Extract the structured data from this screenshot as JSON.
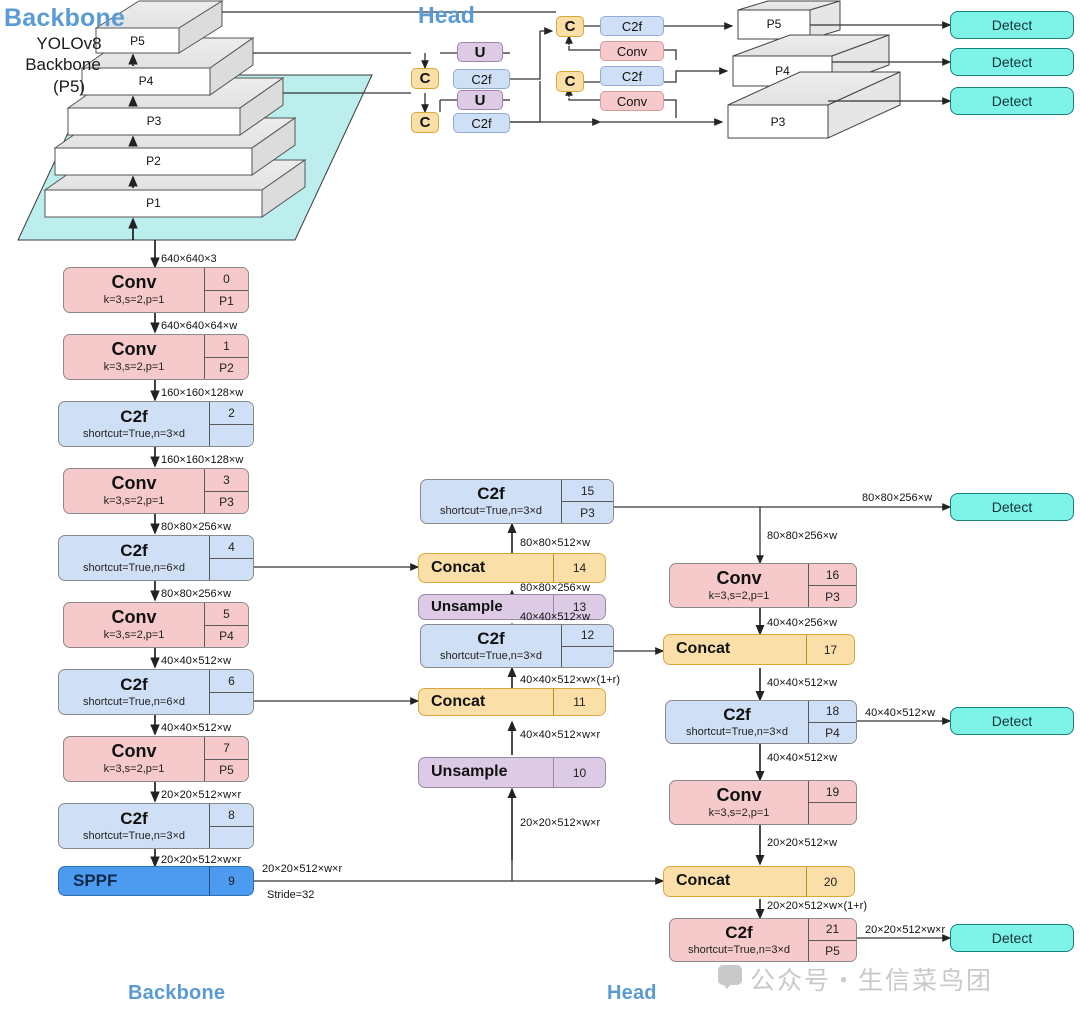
{
  "titles": {
    "backbone_top": "Backbone",
    "head_top": "Head",
    "backbone_bottom": "Backbone",
    "head_bottom": "Head"
  },
  "pyramid": {
    "caption_line1": "YOLOv8",
    "caption_line2": "Backbone",
    "caption_line3": "(P5)",
    "levels": [
      "P5",
      "P4",
      "P3",
      "P2",
      "P1"
    ],
    "input_label": "640×640×3"
  },
  "head_mini": {
    "concat_top": "C",
    "concat_mid": "C",
    "concat_bot": "C",
    "upsample_top": "U",
    "upsample_bot": "U",
    "c2f_top": "C2f",
    "c2f_mid": "C2f",
    "c2f_bot": "C2f",
    "right_c_top": "C",
    "right_c_bot": "C",
    "right_c2f_top": "C2f",
    "right_c2f_bot": "C2f",
    "right_conv_top": "Conv",
    "right_conv_bot": "Conv"
  },
  "head_out_levels": [
    "P5",
    "P4",
    "P3"
  ],
  "detect_label": "Detect",
  "detect_boxes": [
    {
      "label": "Detect"
    },
    {
      "label": "Detect"
    },
    {
      "label": "Detect"
    }
  ],
  "backbone_nodes": [
    {
      "title": "Conv",
      "sub": "k=3,s=2,p=1",
      "idx": "0",
      "tag": "P1",
      "color": "conv"
    },
    {
      "title": "Conv",
      "sub": "k=3,s=2,p=1",
      "idx": "1",
      "tag": "P2",
      "color": "conv"
    },
    {
      "title": "C2f",
      "sub": "shortcut=True,n=3×d",
      "idx": "2",
      "tag": "",
      "color": "c2f"
    },
    {
      "title": "Conv",
      "sub": "k=3,s=2,p=1",
      "idx": "3",
      "tag": "P3",
      "color": "conv"
    },
    {
      "title": "C2f",
      "sub": "shortcut=True,n=6×d",
      "idx": "4",
      "tag": "",
      "color": "c2f"
    },
    {
      "title": "Conv",
      "sub": "k=3,s=2,p=1",
      "idx": "5",
      "tag": "P4",
      "color": "conv"
    },
    {
      "title": "C2f",
      "sub": "shortcut=True,n=6×d",
      "idx": "6",
      "tag": "",
      "color": "c2f"
    },
    {
      "title": "Conv",
      "sub": "k=3,s=2,p=1",
      "idx": "7",
      "tag": "P5",
      "color": "conv"
    },
    {
      "title": "C2f",
      "sub": "shortcut=True,n=3×d",
      "idx": "8",
      "tag": "",
      "color": "c2f"
    },
    {
      "title": "SPPF",
      "sub": "",
      "idx": "9",
      "tag": "",
      "color": "sppf"
    }
  ],
  "backbone_edges": [
    "640×640×3",
    "640×640×64×w",
    "160×160×128×w",
    "160×160×128×w",
    "80×80×256×w",
    "80×80×256×w",
    "40×40×512×w",
    "40×40×512×w",
    "20×20×512×w×r",
    "20×20×512×w×r"
  ],
  "mid_nodes": [
    {
      "title": "C2f",
      "sub": "shortcut=True,n=3×d",
      "idx": "15",
      "tag": "P3",
      "color": "c2f"
    },
    {
      "title": "Concat",
      "sub": "",
      "idx": "14",
      "tag": "",
      "color": "concat"
    },
    {
      "title": "Unsample",
      "sub": "",
      "idx": "13",
      "tag": "",
      "color": "up"
    },
    {
      "title": "C2f",
      "sub": "shortcut=True,n=3×d",
      "idx": "12",
      "tag": "",
      "color": "c2f"
    },
    {
      "title": "Concat",
      "sub": "",
      "idx": "11",
      "tag": "",
      "color": "concat"
    },
    {
      "title": "Unsample",
      "sub": "",
      "idx": "10",
      "tag": "",
      "color": "up"
    }
  ],
  "mid_edges": {
    "c2f15_in": "80×80×512×w",
    "concat14_in": "80×80×256×w",
    "unsample13_in": "40×40×512×w",
    "c2f12_in": "40×40×512×w×(1+r)",
    "concat11_in": "40×40×512×w×r",
    "unsample10_in": "20×20×512×w×r"
  },
  "right_nodes": [
    {
      "title": "Conv",
      "sub": "k=3,s=2,p=1",
      "idx": "16",
      "tag": "P3",
      "color": "conv"
    },
    {
      "title": "Concat",
      "sub": "",
      "idx": "17",
      "tag": "",
      "color": "concat"
    },
    {
      "title": "C2f",
      "sub": "shortcut=True,n=3×d",
      "idx": "18",
      "tag": "P4",
      "color": "c2f"
    },
    {
      "title": "Conv",
      "sub": "k=3,s=2,p=1",
      "idx": "19",
      "tag": "",
      "color": "conv"
    },
    {
      "title": "Concat",
      "sub": "",
      "idx": "20",
      "tag": "",
      "color": "concat"
    },
    {
      "title": "C2f",
      "sub": "shortcut=True,n=3×d",
      "idx": "21",
      "tag": "P5",
      "color": "conv"
    }
  ],
  "right_edges": {
    "to_detect_p3": "80×80×256×w",
    "conv16_in": "80×80×256×w",
    "concat17_in": "40×40×256×w",
    "c2f18_in": "40×40×512×w",
    "to_detect_p4": "40×40×512×w",
    "conv19_in": "40×40×512×w",
    "concat20_in": "20×20×512×w",
    "c2f21_in": "20×20×512×w×(1+r)",
    "to_detect_p5": "20×20×512×w×r"
  },
  "sppf_out": {
    "dims": "20×20×512×w×r",
    "stride": "Stride=32"
  },
  "watermark": {
    "text": "公众号・生信菜鸟团"
  },
  "colors": {
    "accent_blue": "#5b9bd5",
    "conv_pink": "#f6c9cb",
    "c2f_blue": "#cfdff5",
    "sppf_blue": "#4d9bf0",
    "concat_orange": "#fbdfa8",
    "upsample_purple": "#ddcbe6",
    "detect_cyan": "#7ef3e8",
    "base_plate": "#bdeeee"
  }
}
